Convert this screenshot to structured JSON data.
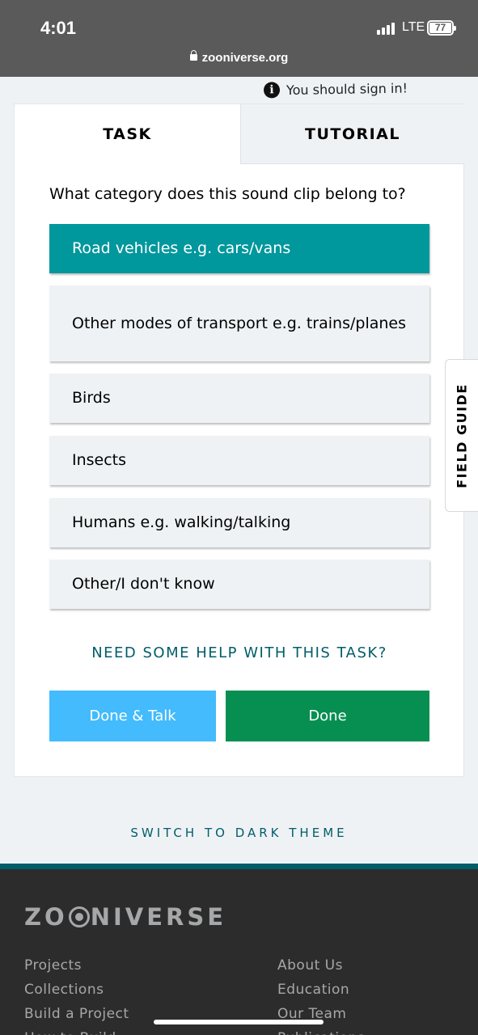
{
  "status_bar": {
    "time": "4:01",
    "network": "LTE",
    "battery": "77",
    "url": "zooniverse.org"
  },
  "notice": {
    "text": "You should sign in!"
  },
  "tabs": {
    "task": "TASK",
    "tutorial": "TUTORIAL"
  },
  "question": "What category does this sound clip belong to?",
  "answers": [
    {
      "label": "Road vehicles e.g. cars/vans",
      "selected": true
    },
    {
      "label": "Other modes of transport e.g. trains/planes",
      "selected": false
    },
    {
      "label": "Birds",
      "selected": false
    },
    {
      "label": "Insects",
      "selected": false
    },
    {
      "label": "Humans e.g. walking/talking",
      "selected": false
    },
    {
      "label": "Other/I don't know",
      "selected": false
    }
  ],
  "help_link": "NEED SOME HELP WITH THIS TASK?",
  "buttons": {
    "done_talk": "Done & Talk",
    "done": "Done"
  },
  "field_guide": "FIELD GUIDE",
  "theme_switch": "SWITCH TO DARK THEME",
  "footer": {
    "logo": "ZOONIVERSE",
    "left_links": [
      "Projects",
      "Collections",
      "Build a Project",
      "How to Build"
    ],
    "right_links": [
      "About Us",
      "Education",
      "Our Team",
      "Publications"
    ]
  },
  "colors": {
    "selected_answer": "#00979d",
    "done_talk": "#43bbfd",
    "done": "#078f52",
    "link": "#005d69",
    "footer_bg": "#2c2c2c"
  }
}
